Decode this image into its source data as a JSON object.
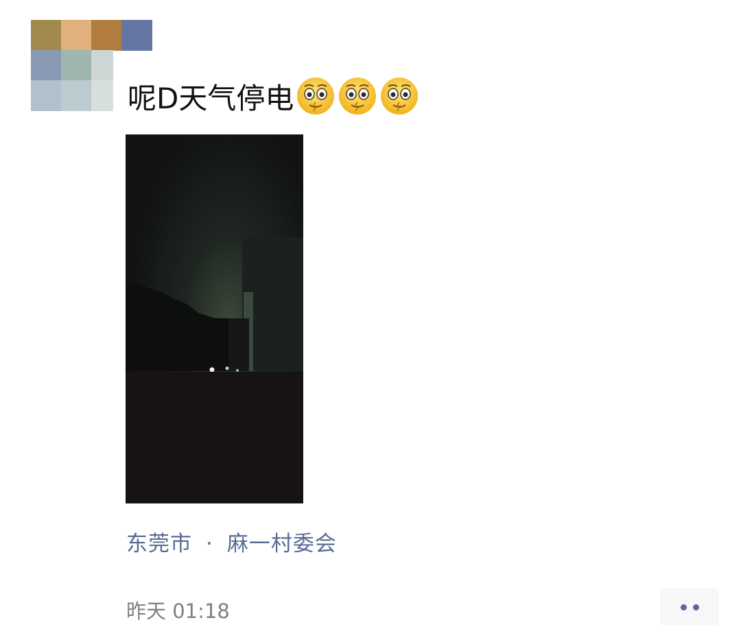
{
  "post": {
    "text": "呢D天气停电",
    "emojis": [
      "dizzy-face-emoji",
      "dizzy-face-emoji",
      "dizzy-face-emoji"
    ],
    "location": {
      "city": "东莞市",
      "separator": "·",
      "place": "麻一村委会"
    },
    "time": "昨天 01:18"
  },
  "avatar": {
    "colors": [
      "#a28a4c",
      "#e1b17d",
      "#b07d3e",
      "#6576a3",
      "#8b9ab4",
      "#9fb6ae",
      "#cdd5d5",
      "#b2c0cc",
      "#bccbd0",
      "#d7dfde"
    ]
  },
  "colors": {
    "link": "#576b95",
    "text": "#111111",
    "timestamp": "#7f7f7f",
    "more_button_bg": "#f7f7f7"
  },
  "icons": {
    "more": "more-dots-icon"
  }
}
